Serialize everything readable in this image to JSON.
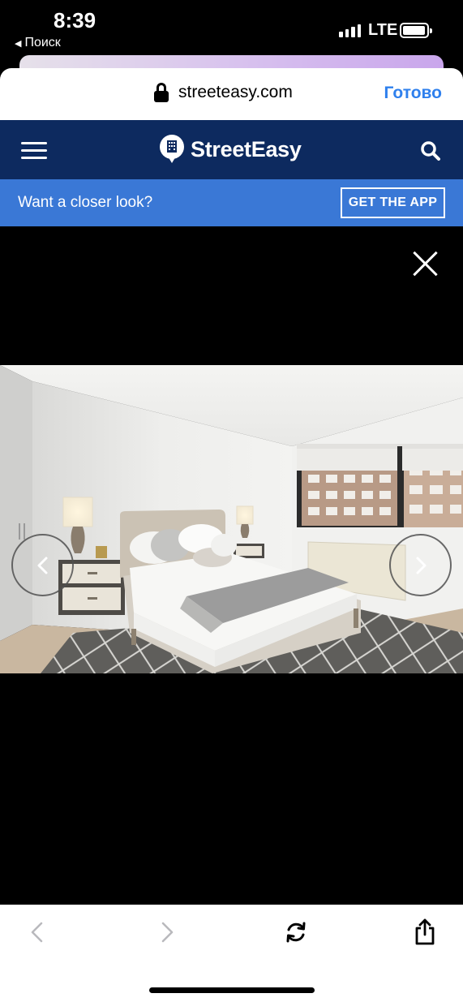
{
  "status_bar": {
    "time": "8:39",
    "back_label": "Поиск",
    "network": "LTE"
  },
  "browser": {
    "url": "streeteasy.com",
    "done_label": "Готово"
  },
  "site_header": {
    "logo_text": "StreetEasy",
    "brand_color": "#0d2a5f"
  },
  "promo": {
    "text": "Want a closer look?",
    "button_label": "GET THE APP",
    "color": "#3a78d6"
  },
  "viewer": {
    "photo": "bedroom-listing-photo",
    "icons": [
      "close-icon",
      "chevron-left-icon",
      "chevron-right-icon"
    ]
  },
  "toolbar": {
    "icons": [
      "back-icon",
      "forward-icon",
      "reload-icon",
      "share-icon"
    ]
  }
}
